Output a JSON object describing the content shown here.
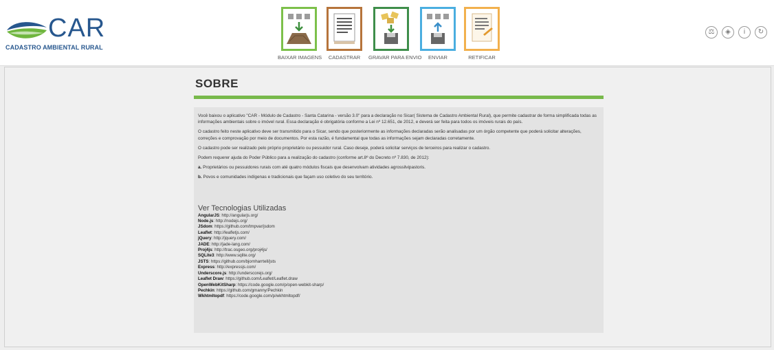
{
  "brand": {
    "logo_text": "CAR",
    "logo_subtitle": "CADASTRO AMBIENTAL RURAL",
    "colors": {
      "blue": "#27578e",
      "green": "#78b94b"
    }
  },
  "toolbar": {
    "items": [
      {
        "label": "BAIXAR IMAGENS",
        "icon": "download-images-icon",
        "color": "#7cc04a"
      },
      {
        "label": "CADASTRAR",
        "icon": "register-document-icon",
        "color": "#b6743b"
      },
      {
        "label": "GRAVAR PARA ENVIO",
        "icon": "save-for-sending-icon",
        "color": "#3e8e4a"
      },
      {
        "label": "ENVIAR",
        "icon": "send-icon",
        "color": "#4aaee0"
      },
      {
        "label": "RETIFICAR",
        "icon": "rectify-icon",
        "color": "#f2b04d"
      }
    ]
  },
  "header_icons": [
    {
      "name": "scale-icon",
      "glyph": "⚖"
    },
    {
      "name": "layers-icon",
      "glyph": "◈"
    },
    {
      "name": "info-icon",
      "glyph": "i"
    },
    {
      "name": "refresh-icon",
      "glyph": "↻"
    }
  ],
  "page": {
    "title": "SOBRE",
    "paragraphs": [
      "Você baixou o aplicativo \"CAR - Módulo de Cadastro - Santa Catarina - versão 3.0\" para a declaração no Sicar(        Sistema   de Cadastro Ambiental Rural), que permite cadastrar de forma simplificada todas as informações ambientais sobre o imóvel rural. Essa declaração é obrigatória conforme a Lei nº 12.651, de 2012, e deverá ser feita para todos os imóveis rurais do país.",
      "O cadastro feito neste aplicativo deve ser transmitido para o Sicar, sendo que posteriormente as informações declaradas serão analisadas por um órgão competente que poderá solicitar alterações, correções e comprovação por meio de documentos. Por esta razão, é fundamental que todas as informações sejam declaradas corretamente.",
      "O cadastro pode ser realizado pelo próprio proprietário ou pessuidor rural. Caso deseje, poderá solicitar serviços de terceiros para realizar o cadastro.",
      "Podem requerer ajuda do Poder Público para a realização do cadastro (conforme art.8º do Decreto nº 7.830, de 2012):"
    ],
    "items": [
      {
        "marker": "a.",
        "text": " Proprietários ou pessuidores rurais com até quatro módulos fiscais que desenvolvam atividades agrossilvipastoris."
      },
      {
        "marker": "b.",
        "text": " Povos e comunidades indígenas e tradicionais que façam uso coletivo do seu território."
      }
    ],
    "tech_title": "Ver Tecnologias Utilizadas",
    "technologies": [
      {
        "name": "AngularJS",
        "url": ": http://angularjs.org/"
      },
      {
        "name": "Node.js",
        "url": ": http://nodejs.org/"
      },
      {
        "name": "JSdom",
        "url": ": https://github.com/tmpvar/jsdom"
      },
      {
        "name": "Leaflet",
        "url": ": http://leafletjs.com/"
      },
      {
        "name": "jQuery",
        "url": ": http://jquery.com/"
      },
      {
        "name": "JADE",
        "url": ": http://jade-lang.com/"
      },
      {
        "name": "Proj4js",
        "url": ": http://trac.osgeo.org/proj4js/"
      },
      {
        "name": "SQLite3",
        "url": ": http://www.sqlite.org/"
      },
      {
        "name": "JSTS",
        "url": ": https://github.com/bjornharrtell/jsts"
      },
      {
        "name": "Express",
        "url": ": http://expressjs.com/"
      },
      {
        "name": "Underscore.js",
        "url": ": http://underscorejs.org/"
      },
      {
        "name": "Leaflet Draw",
        "url": ": https://github.com/Leaflet/Leaflet.draw"
      },
      {
        "name": "OpenWebKitSharp",
        "url": ": https://code.google.com/p/open-webkit-sharp/"
      },
      {
        "name": "Pechkin",
        "url": ": https://github.com/gmanny/Pechkin"
      },
      {
        "name": "Wkhtmltopdf",
        "url": ": https://code.google.com/p/wkhtmltopdf/"
      }
    ]
  }
}
